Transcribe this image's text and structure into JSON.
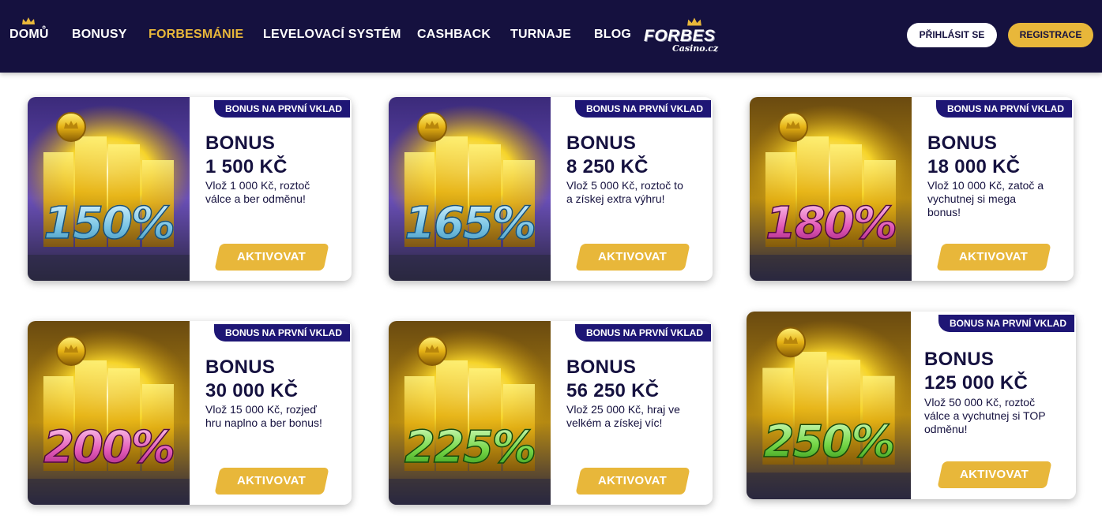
{
  "nav": {
    "items": [
      "DOMŮ",
      "BONUSY",
      "FORBESMÁNIE",
      "LEVELOVACÍ SYSTÉM",
      "CASHBACK",
      "TURNAJE",
      "BLOG"
    ],
    "active": "FORBESMÁNIE"
  },
  "logo": {
    "main": "FORBES",
    "sub": "Casino.cz"
  },
  "auth": {
    "login": "PŘIHLÁSIT SE",
    "register": "REGISTRACE"
  },
  "colors": {
    "header": "#15113f",
    "accent": "#e8b73a",
    "ribbon": "#1e1675"
  },
  "cards": [
    {
      "ribbon": "BONUS NA PRVNÍ VKLAD",
      "title": "BONUS",
      "amount": "1 500 KČ",
      "desc1": "Vlož 1 000 Kč, roztoč",
      "desc2": "válce a ber odměnu!",
      "desc3": "",
      "percent": "150%",
      "button": "AKTIVOVAT",
      "percent_color": "blue"
    },
    {
      "ribbon": "BONUS NA PRVNÍ VKLAD",
      "title": "BONUS",
      "amount": "8 250 KČ",
      "desc1": "Vlož 5 000 Kč, roztoč to",
      "desc2": "a získej extra výhru!",
      "desc3": "",
      "percent": "165%",
      "button": "AKTIVOVAT",
      "percent_color": "blue"
    },
    {
      "ribbon": "BONUS NA PRVNÍ VKLAD",
      "title": "BONUS",
      "amount": "18 000 KČ",
      "desc1": "Vlož 10 000 Kč, zatoč a",
      "desc2": "vychutnej si mega",
      "desc3": "bonus!",
      "percent": "180%",
      "button": "AKTIVOVAT",
      "percent_color": "pink"
    },
    {
      "ribbon": "BONUS NA PRVNÍ VKLAD",
      "title": "BONUS",
      "amount": "30 000 KČ",
      "desc1": "Vlož 15 000 Kč, rozjeď",
      "desc2": "hru naplno a ber bonus!",
      "desc3": "",
      "percent": "200%",
      "button": "AKTIVOVAT",
      "percent_color": "pink"
    },
    {
      "ribbon": "BONUS NA PRVNÍ VKLAD",
      "title": "BONUS",
      "amount": "56 250 KČ",
      "desc1": "Vlož 25 000 Kč, hraj ve",
      "desc2": "velkém a získej víc!",
      "desc3": "",
      "percent": "225%",
      "button": "AKTIVOVAT",
      "percent_color": "green"
    },
    {
      "ribbon": "BONUS NA PRVNÍ VKLAD",
      "title": "BONUS",
      "amount": "125 000 KČ",
      "desc1": "Vlož 50 000 Kč, roztoč",
      "desc2": "válce a vychutnej si TOP",
      "desc3": "odměnu!",
      "percent": "250%",
      "button": "AKTIVOVAT",
      "percent_color": "green"
    }
  ]
}
